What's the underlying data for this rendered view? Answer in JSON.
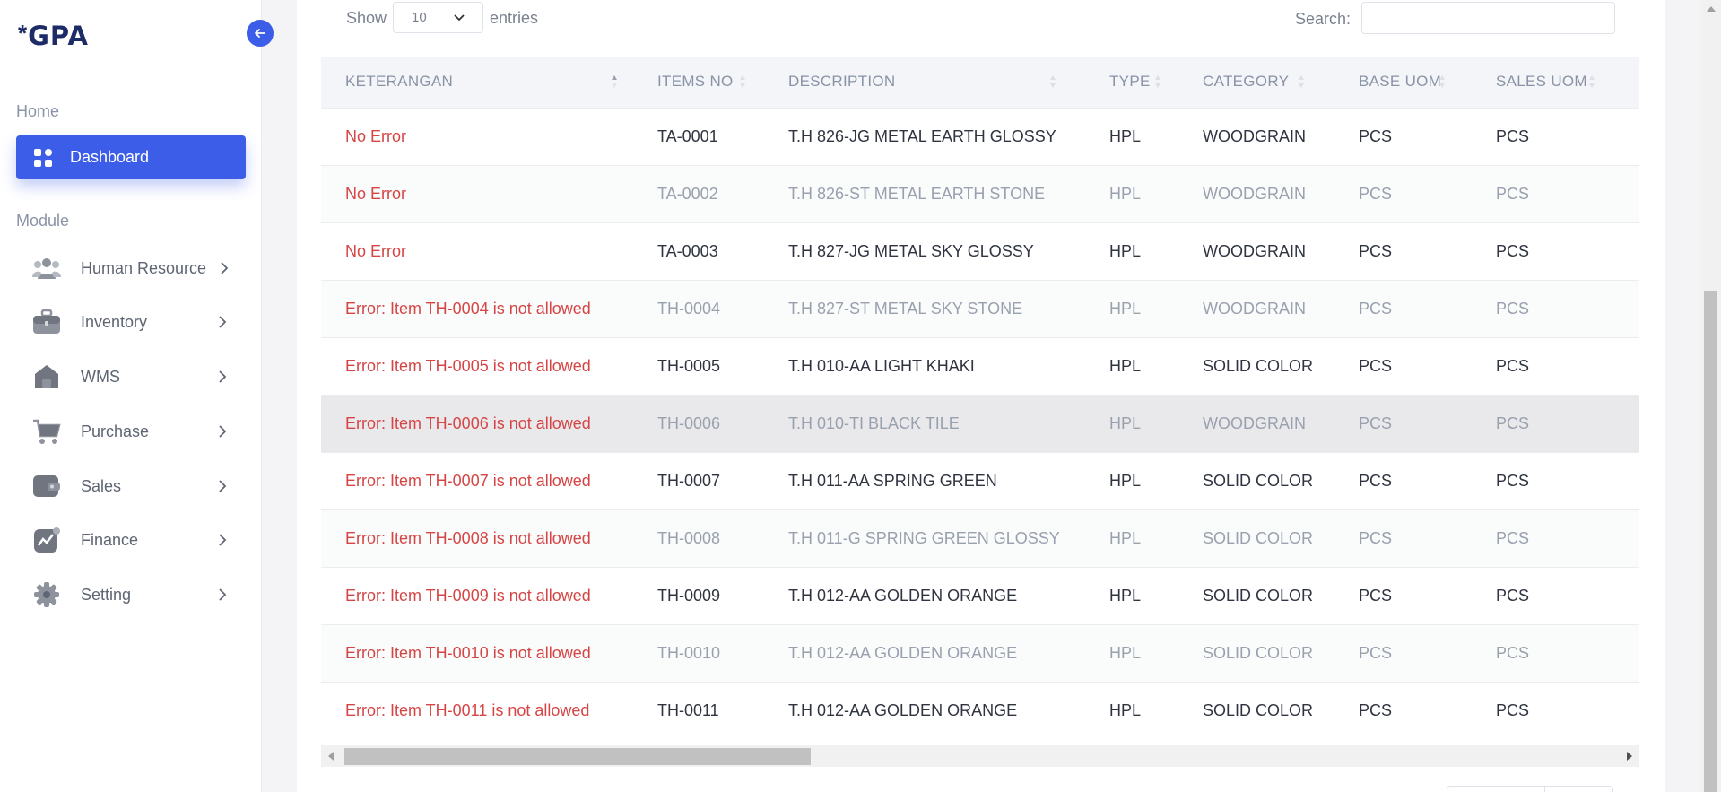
{
  "brand": {
    "logo_star": "*",
    "logo_text": "GPA"
  },
  "sidebar": {
    "home_label": "Home",
    "dashboard_label": "Dashboard",
    "module_label": "Module",
    "items": [
      {
        "label": "Human Resource",
        "icon": "users-icon"
      },
      {
        "label": "Inventory",
        "icon": "briefcase-icon"
      },
      {
        "label": "WMS",
        "icon": "warehouse-icon"
      },
      {
        "label": "Purchase",
        "icon": "cart-icon"
      },
      {
        "label": "Sales",
        "icon": "wallet-icon"
      },
      {
        "label": "Finance",
        "icon": "chart-icon"
      },
      {
        "label": "Setting",
        "icon": "gear-icon"
      }
    ]
  },
  "controls": {
    "show_label": "Show",
    "entries_value": "10",
    "entries_label": "entries",
    "search_label": "Search:",
    "search_value": ""
  },
  "table": {
    "columns": [
      "KETERANGAN",
      "ITEMS NO",
      "DESCRIPTION",
      "TYPE",
      "CATEGORY",
      "BASE UOM",
      "SALES UOM"
    ],
    "sorted_column": "KETERANGAN",
    "sort_direction": "asc",
    "highlighted_row": 5,
    "rows": [
      [
        "No Error",
        "TA-0001",
        "T.H 826-JG METAL EARTH GLOSSY",
        "HPL",
        "WOODGRAIN",
        "PCS",
        "PCS"
      ],
      [
        "No Error",
        "TA-0002",
        "T.H 826-ST METAL EARTH STONE",
        "HPL",
        "WOODGRAIN",
        "PCS",
        "PCS"
      ],
      [
        "No Error",
        "TA-0003",
        "T.H 827-JG METAL SKY GLOSSY",
        "HPL",
        "WOODGRAIN",
        "PCS",
        "PCS"
      ],
      [
        "Error: Item TH-0004 is not allowed",
        "TH-0004",
        "T.H 827-ST METAL SKY STONE",
        "HPL",
        "WOODGRAIN",
        "PCS",
        "PCS"
      ],
      [
        "Error: Item TH-0005 is not allowed",
        "TH-0005",
        "T.H 010-AA LIGHT KHAKI",
        "HPL",
        "SOLID COLOR",
        "PCS",
        "PCS"
      ],
      [
        "Error: Item TH-0006 is not allowed",
        "TH-0006",
        "T.H 010-TI BLACK TILE",
        "HPL",
        "WOODGRAIN",
        "PCS",
        "PCS"
      ],
      [
        "Error: Item TH-0007 is not allowed",
        "TH-0007",
        "T.H 011-AA SPRING GREEN",
        "HPL",
        "SOLID COLOR",
        "PCS",
        "PCS"
      ],
      [
        "Error: Item TH-0008 is not allowed",
        "TH-0008",
        "T.H 011-G SPRING GREEN GLOSSY",
        "HPL",
        "SOLID COLOR",
        "PCS",
        "PCS"
      ],
      [
        "Error: Item TH-0009 is not allowed",
        "TH-0009",
        "T.H 012-AA GOLDEN ORANGE",
        "HPL",
        "SOLID COLOR",
        "PCS",
        "PCS"
      ],
      [
        "Error: Item TH-0010 is not allowed",
        "TH-0010",
        "T.H 012-AA GOLDEN ORANGE",
        "HPL",
        "SOLID COLOR",
        "PCS",
        "PCS"
      ],
      [
        "Error: Item TH-0011 is not allowed",
        "TH-0011",
        "T.H 012-AA GOLDEN ORANGE",
        "HPL",
        "SOLID COLOR",
        "PCS",
        "PCS"
      ]
    ]
  },
  "colors": {
    "accent": "#3b5de7",
    "error_text": "#d64545",
    "brand_text": "#1d2b66"
  }
}
